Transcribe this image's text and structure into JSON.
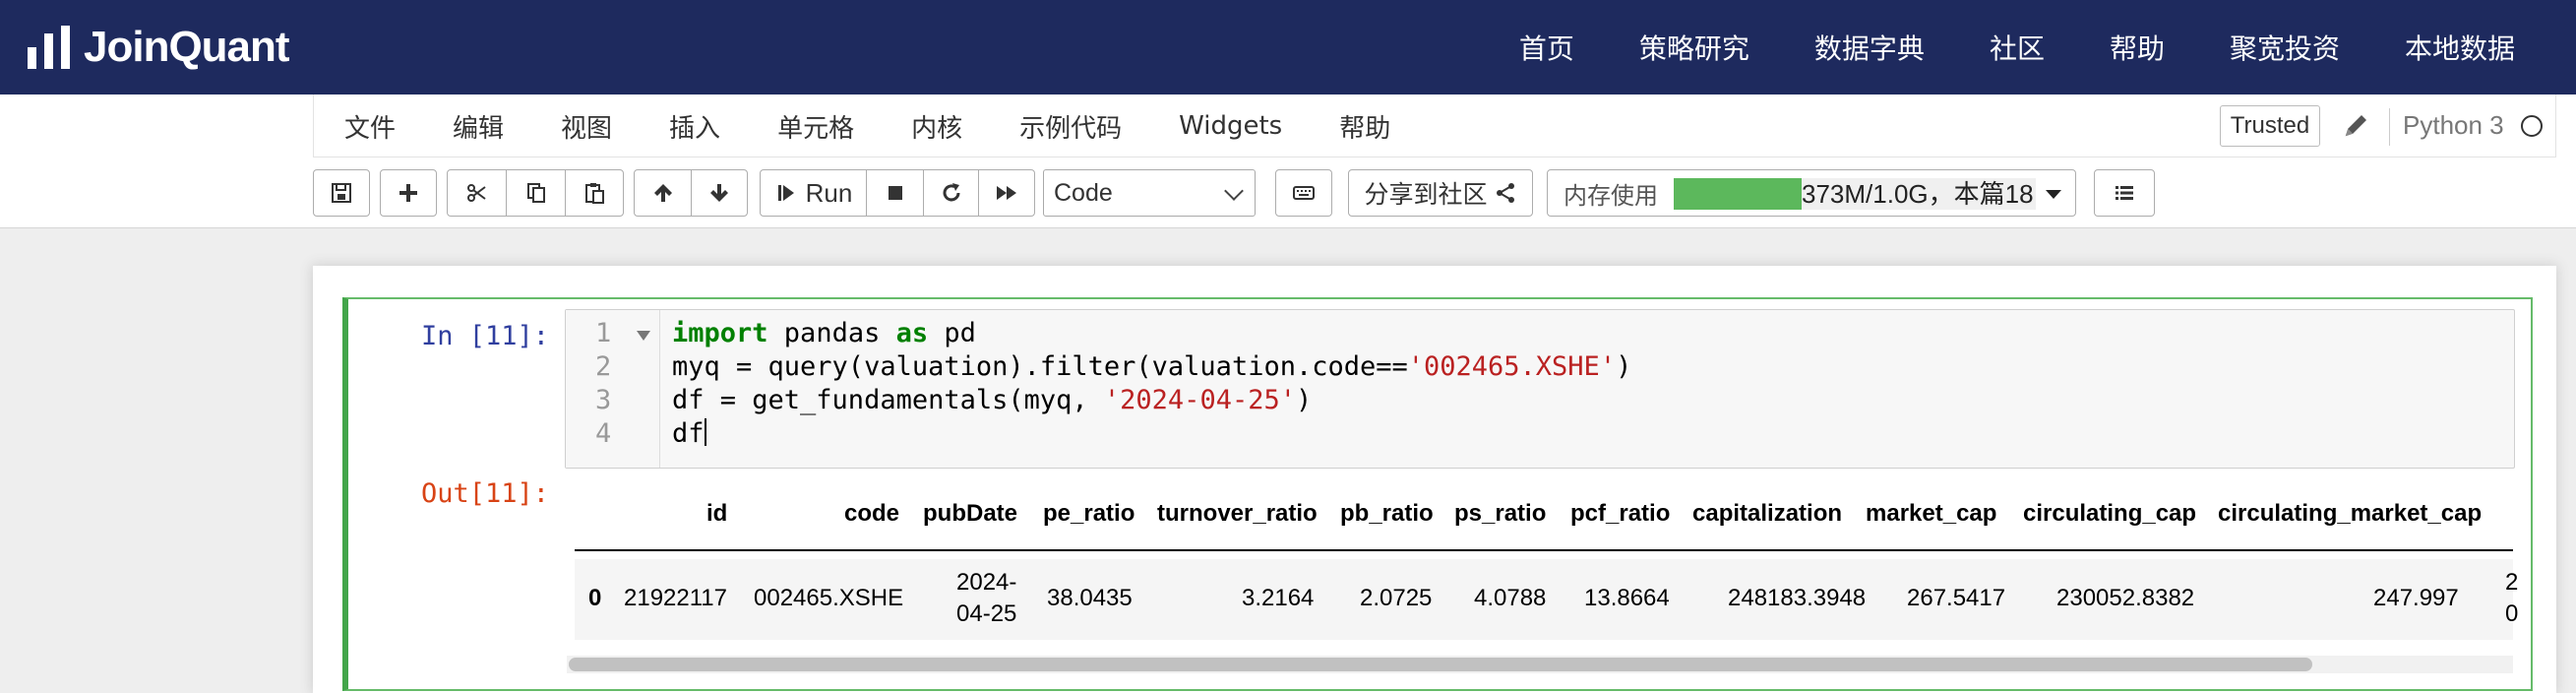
{
  "brand": {
    "name": "JoinQuant"
  },
  "nav": [
    "首页",
    "策略研究",
    "数据字典",
    "社区",
    "帮助",
    "聚宽投资",
    "本地数据"
  ],
  "menu": [
    "文件",
    "编辑",
    "视图",
    "插入",
    "单元格",
    "内核",
    "示例代码",
    "Widgets",
    "帮助"
  ],
  "status": {
    "trusted": "Trusted",
    "kernel": "Python 3"
  },
  "toolbar": {
    "run_label": "Run",
    "cell_type": "Code",
    "share_label": "分享到社区",
    "memory_label": "内存使用",
    "memory_text": "373M/1.0G，本篇18"
  },
  "cell": {
    "in_prompt": "In [11]:",
    "out_prompt": "Out[11]:",
    "line_numbers": [
      "1",
      "2",
      "3",
      "4"
    ],
    "code": [
      [
        "import",
        " pandas ",
        "as",
        " pd"
      ],
      [
        "myq = query(valuation).filter(valuation.code==",
        "'002465.XSHE'",
        ")"
      ],
      [
        "df = get_fundamentals(myq, ",
        "'2024-04-25'",
        ")"
      ],
      [
        "df"
      ]
    ]
  },
  "table": {
    "columns": [
      "id",
      "code",
      "pubDate",
      "pe_ratio",
      "turnover_ratio",
      "pb_ratio",
      "ps_ratio",
      "pcf_ratio",
      "capitalization",
      "market_cap",
      "circulating_cap",
      "circulating_market_cap"
    ],
    "rows": [
      {
        "index": "0",
        "cells": [
          "21922117",
          "002465.XSHE",
          "2024-",
          "04-25",
          "38.0435",
          "3.2164",
          "2.0725",
          "4.0788",
          "13.8664",
          "248183.3948",
          "267.5417",
          "230052.8382",
          "247.997"
        ],
        "overflow_top": "2",
        "overflow_bottom": "0"
      }
    ]
  }
}
